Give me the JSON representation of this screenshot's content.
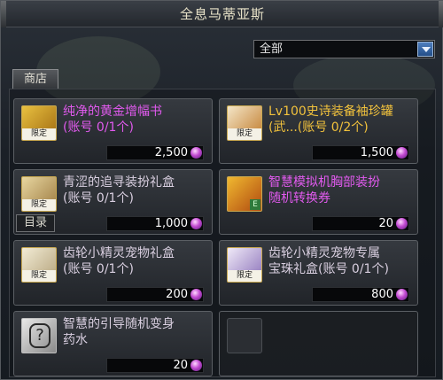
{
  "window": {
    "title": "全息马蒂亚斯"
  },
  "filter": {
    "selected": "全部"
  },
  "tabs": {
    "shop": "商店",
    "catalog": "目录"
  },
  "limit_badge": "限定",
  "items": [
    {
      "name": "纯净的黄金增幅书\n(账号 0/1个)",
      "price": "2,500",
      "name_color": "purple",
      "icon": "golden-book-icon",
      "limited": true,
      "e_badge": false
    },
    {
      "name": "Lv100史诗装备袖珍罐\n(武...(账号 0/2个)",
      "price": "1,500",
      "name_color": "gold",
      "icon": "epic-jar-icon",
      "limited": true,
      "e_badge": false
    },
    {
      "name": "青涩的追寻装扮礼盒\n(账号 0/1个)",
      "price": "1,000",
      "name_color": "normal",
      "icon": "gift-box-icon",
      "limited": true,
      "e_badge": false
    },
    {
      "name": "智慧模拟机胸部装扮\n随机转换券",
      "price": "20",
      "name_color": "purple",
      "icon": "ticket-icon",
      "limited": false,
      "e_badge": true
    },
    {
      "name": "齿轮小精灵宠物礼盒\n(账号 0/1个)",
      "price": "200",
      "name_color": "normal",
      "icon": "pet-box-icon",
      "limited": true,
      "e_badge": false
    },
    {
      "name": "齿轮小精灵宠物专属\n宝珠礼盒(账号 0/1个)",
      "price": "800",
      "name_color": "normal",
      "icon": "orb-box-icon",
      "limited": true,
      "e_badge": false
    },
    {
      "name": "智慧的引导随机变身\n药水",
      "price": "20",
      "name_color": "normal",
      "icon": "potion-icon",
      "limited": false,
      "e_badge": false
    }
  ]
}
